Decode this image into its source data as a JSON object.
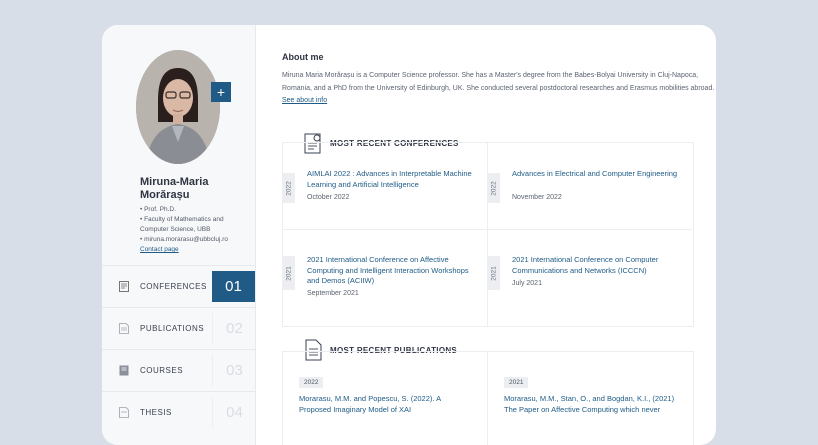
{
  "profile": {
    "name": "Miruna-Maria Morărașu",
    "title_line": "• Prof. Ph.D.",
    "faculty_line": "• Faculty of Mathematics and Computer Science, UBB",
    "email_line": "• miruna.morarasu@ubbcluj.ro",
    "contact_link": "Contact page",
    "plus_label": "+"
  },
  "nav": {
    "items": [
      {
        "label": "CONFERENCES",
        "num": "01",
        "icon": "conference-icon"
      },
      {
        "label": "PUBLICATIONS",
        "num": "02",
        "icon": "document-icon"
      },
      {
        "label": "COURSES",
        "num": "03",
        "icon": "book-icon"
      },
      {
        "label": "THESIS",
        "num": "04",
        "icon": "document-icon"
      }
    ]
  },
  "about": {
    "title": "About me",
    "text": "Miruna Maria Morărașu is a Computer Science professor. She has a Master's degree from the Babes-Bolyai University in Cluj-Napoca, Romania, and a PhD from the University of Edinburgh, UK. She conducted several postdoctoral researches and Erasmus mobilities abroad.",
    "link": "See about info"
  },
  "conferences": {
    "title": "MOST RECENT CONFERENCES",
    "items": [
      {
        "year": "2022",
        "title": "AIMLAI 2022 : Advances in Interpretable Machine Learning and Artificial Intelligence",
        "date": "October 2022"
      },
      {
        "year": "2022",
        "title": "Advances in Electrical and Computer Engineering",
        "date": "November 2022"
      },
      {
        "year": "2021",
        "title": "2021 International Conference on Affective Computing and Intelligent Interaction Workshops and Demos (ACIIW)",
        "date": "September 2021"
      },
      {
        "year": "2021",
        "title": "2021 International Conference on Computer Communications and Networks (ICCCN)",
        "date": "July 2021"
      }
    ]
  },
  "publications": {
    "title": "MOST RECENT PUBLICATIONS",
    "items": [
      {
        "year": "2022",
        "title": "Morarasu, M.M. and Popescu, S. (2022). A Proposed Imaginary Model of XAI"
      },
      {
        "year": "2021",
        "title": "Morarasu, M.M., Stan, O., and Bogdan, K.I., (2021) The Paper on Affective Computing which never"
      }
    ]
  },
  "colors": {
    "accent": "#1f5b86",
    "background": "#d8dee8"
  }
}
